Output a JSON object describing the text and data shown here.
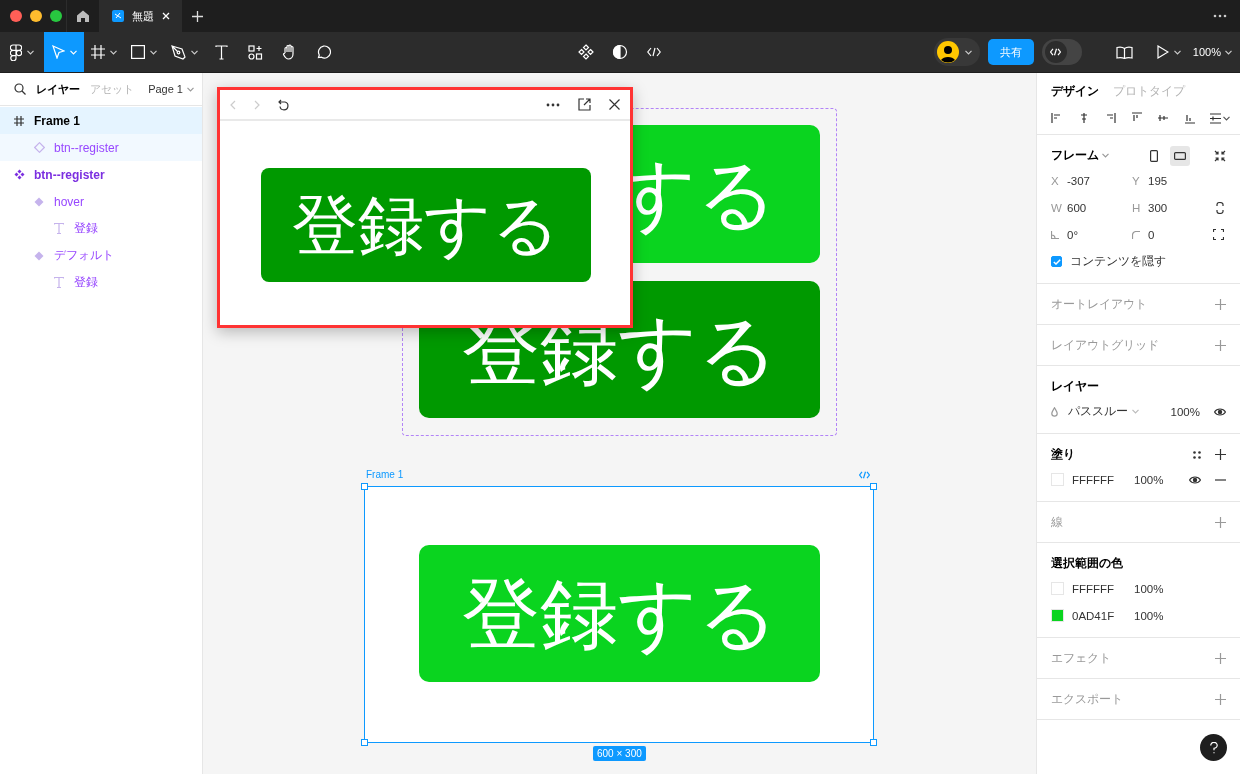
{
  "titlebar": {
    "tabs": [
      {
        "label": "無題",
        "selected": true
      }
    ]
  },
  "toolbar": {
    "tools": [
      {
        "selected": false
      },
      {
        "selected": true
      },
      {
        "selected": false
      },
      {
        "selected": false
      },
      {
        "selected": false
      },
      {
        "selected": false
      },
      {
        "selected": false
      },
      {
        "selected": false
      },
      {
        "selected": false
      }
    ],
    "share_button": "共有",
    "dev_mode": {
      "on": false
    },
    "zoom": "100%"
  },
  "layers_panel": {
    "tabs": [
      {
        "label": "レイヤー",
        "selected": true
      },
      {
        "label": "アセット",
        "selected": false
      }
    ],
    "page": "Page 1",
    "tree": [
      {
        "kind": "frame",
        "name": "Frame 1",
        "selected": true,
        "children": [
          {
            "kind": "instance",
            "name": "btn--register",
            "selected": false
          }
        ]
      },
      {
        "kind": "component-set",
        "name": "btn--register",
        "selected": false,
        "children": [
          {
            "kind": "variant",
            "name": "hover",
            "selected": false,
            "children": [
              {
                "kind": "text",
                "name": "登録",
                "selected": false
              }
            ]
          },
          {
            "kind": "variant",
            "name": "デフォルト",
            "selected": false,
            "children": [
              {
                "kind": "text",
                "name": "登録",
                "selected": false
              }
            ]
          }
        ]
      }
    ]
  },
  "canvas": {
    "component_set": {
      "variants": [
        {
          "label": "する",
          "color": "#0ad41f"
        },
        {
          "label": "登録する",
          "color": "#009900"
        }
      ]
    },
    "frame": {
      "name": "Frame 1",
      "selected": true,
      "button": {
        "label": "登録する",
        "color": "#0ad41f"
      },
      "size": "600 × 300"
    },
    "preview": {
      "button": {
        "label": "登録する",
        "color": "#009900"
      }
    }
  },
  "design_panel": {
    "tabs": [
      {
        "label": "デザイン",
        "selected": true
      },
      {
        "label": "プロトタイプ",
        "selected": false
      }
    ],
    "sections": [
      {
        "kind": "frame",
        "title": "フレーム",
        "orientation": [
          {
            "selected": false
          },
          {
            "selected": true
          }
        ],
        "fields": [
          {
            "kind": "text",
            "label": "X",
            "value": "-307"
          },
          {
            "kind": "text",
            "label": "Y",
            "value": "195"
          },
          {
            "kind": "text",
            "label": "W",
            "value": "600"
          },
          {
            "kind": "text",
            "label": "H",
            "value": "300"
          },
          {
            "kind": "rotation",
            "value": "0°"
          },
          {
            "kind": "radius",
            "value": "0"
          }
        ],
        "clip_content": {
          "label": "コンテンツを隠す",
          "checked": true
        }
      },
      {
        "kind": "add",
        "title": "オートレイアウト"
      },
      {
        "kind": "add",
        "title": "レイアウトグリッド"
      },
      {
        "kind": "layer",
        "title": "レイヤー",
        "blend": "パススルー",
        "opacity": "100%"
      },
      {
        "kind": "fill",
        "title": "塗り",
        "fills": [
          {
            "hex": "FFFFFF",
            "opacity": "100%",
            "color": "#ffffff"
          }
        ]
      },
      {
        "kind": "add",
        "title": "線"
      },
      {
        "kind": "colors",
        "title": "選択範囲の色",
        "colors": [
          {
            "hex": "FFFFFF",
            "opacity": "100%",
            "color": "#ffffff"
          },
          {
            "hex": "0AD41F",
            "opacity": "100%",
            "color": "#0ad41f"
          }
        ]
      },
      {
        "kind": "add",
        "title": "エフェクト"
      },
      {
        "kind": "add",
        "title": "エクスポート"
      }
    ]
  }
}
